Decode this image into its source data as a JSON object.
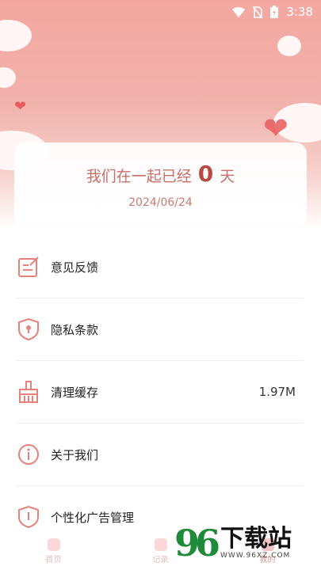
{
  "status_bar": {
    "time": "3:38"
  },
  "counter": {
    "prefix": "我们在一起已经",
    "days": "0",
    "suffix": "天",
    "date": "2024/06/24"
  },
  "menu": {
    "items": [
      {
        "label": "意见反馈",
        "value": "",
        "icon": "feedback-icon"
      },
      {
        "label": "隐私条款",
        "value": "",
        "icon": "privacy-shield-icon"
      },
      {
        "label": "清理缓存",
        "value": "1.97M",
        "icon": "broom-icon"
      },
      {
        "label": "关于我们",
        "value": "",
        "icon": "info-icon"
      },
      {
        "label": "个性化广告管理",
        "value": "",
        "icon": "ad-shield-icon"
      }
    ]
  },
  "bottom_nav": {
    "items": [
      {
        "label": "首页"
      },
      {
        "label": "记录"
      },
      {
        "label": "我的"
      }
    ]
  },
  "watermark": {
    "brand": "下载站",
    "url": "WWW.96XZ.COM",
    "logo": "96"
  },
  "colors": {
    "accent": "#e8817a",
    "hero": "#f3a7a0",
    "text_accent": "#c96f68"
  }
}
